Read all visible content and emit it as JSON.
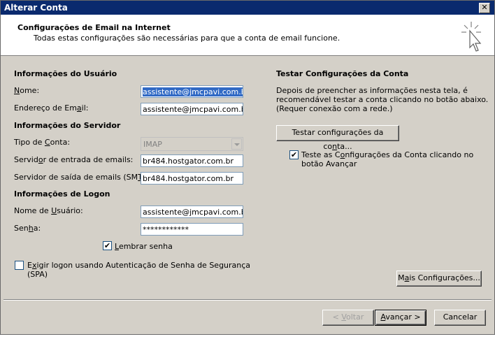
{
  "window": {
    "title": "Alterar Conta",
    "close_glyph": "✕"
  },
  "header": {
    "title": "Configurações de Email na Internet",
    "subtitle": "Todas estas configurações são necessárias para que a conta de email funcione."
  },
  "user_info": {
    "heading": "Informações do Usuário",
    "name_label": "Nome:",
    "name_value": "assistente@jmcpavi.com.br",
    "email_label": "Endereço de Email:",
    "email_value": "assistente@jmcpavi.com.br"
  },
  "server_info": {
    "heading": "Informações do Servidor",
    "account_type_label": "Tipo de Conta:",
    "account_type_value": "IMAP",
    "incoming_label": "Servidor de entrada de emails:",
    "incoming_value": "br484.hostgator.com.br",
    "outgoing_label": "Servidor de saída de emails (SMTP):",
    "outgoing_value": "br484.hostgator.com.br"
  },
  "logon_info": {
    "heading": "Informações de Logon",
    "username_label": "Nome de Usuário:",
    "username_value": "assistente@jmcpavi.com.br",
    "password_label": "Senha:",
    "password_value": "************",
    "remember_label": "Lembrar senha",
    "remember_checked": true,
    "spa_label_line1": "Exigir logon usando Autenticação de Senha de Segurança",
    "spa_label_line2": "(SPA)",
    "spa_checked": false
  },
  "test_settings": {
    "heading": "Testar Configurações da Conta",
    "desc_line1": "Depois de preencher as informações nesta tela, é",
    "desc_line2": "recomendável testar a conta clicando no botão abaixo.",
    "desc_line3": "(Requer conexão com a rede.)",
    "test_button": "Testar configurações da conta...",
    "auto_test_line1": "Teste as Configurações da Conta clicando no",
    "auto_test_line2": "botão Avançar",
    "auto_test_checked": true
  },
  "more_settings_button": "Mais Configurações...",
  "footer": {
    "back_button": "< Voltar",
    "next_button": "Avançar >",
    "cancel_button": "Cancelar"
  }
}
